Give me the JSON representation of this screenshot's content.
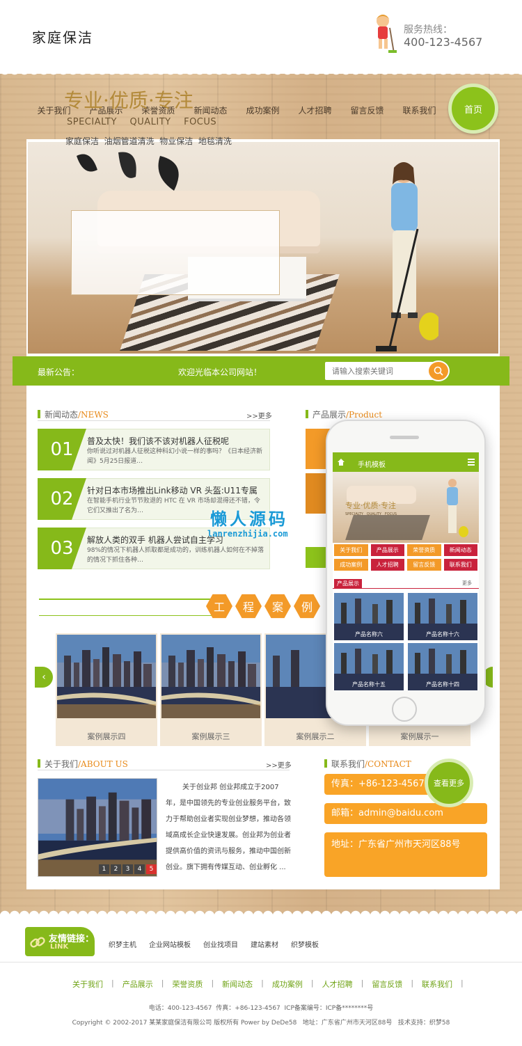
{
  "header": {
    "logo": "家庭保洁",
    "hotline_label": "服务热线：",
    "hotline_number": "400-123-4567"
  },
  "nav": {
    "items": [
      "关于我们",
      "产品展示",
      "荣誉资质",
      "新闻动态",
      "成功案例",
      "人才招聘",
      "留言反馈",
      "联系我们"
    ],
    "home": "首页"
  },
  "banner": {
    "title": "专业·优质·专注",
    "subtitle": "SPECIALTY    QUALITY    FOCUS",
    "services": "家庭保洁  油烟管道清洗  物业保洁  地毯清洗"
  },
  "notice": {
    "label": "最新公告：",
    "text": "欢迎光临本公司网站！",
    "search_placeholder": "请输入搜索关键词"
  },
  "news": {
    "title": "新闻动态",
    "title_en": "/NEWS",
    "more": ">>更多",
    "items": [
      {
        "num": "01",
        "title": "普及太快！我们该不该对机器人征税呢",
        "desc": "你听说过对机器人征税这种科幻小说一样的事吗？《日本经济新闻》5月25日报道…"
      },
      {
        "num": "02",
        "title": "针对日本市场推出Link移动 VR 头盔:U11专属",
        "desc": "在智能手机行业节节败退的 HTC 在 VR 市场却混得还不错，令它们又推出了名为…"
      },
      {
        "num": "03",
        "title": "解放人类的双手 机器人尝试自主学习",
        "desc": "98%的情况下机器人抓取都是成功的，训练机器人如何在不掉落的情况下抓住各种…"
      }
    ]
  },
  "products": {
    "title": "产品展示",
    "title_en": "/Product"
  },
  "cases": {
    "heading_chars": [
      "工",
      "程",
      "案",
      "例"
    ],
    "items": [
      "案例展示四",
      "案例展示三",
      "案例展示二",
      "案例展示一"
    ]
  },
  "about": {
    "title": "关于我们",
    "title_en": "/ABOUT US",
    "more": ">>更多",
    "text": "关于创业邦 创业邦成立于2007年，是中国领先的专业创业服务平台，致力于帮助创业者实现创业梦想，推动各领域高成长企业快速发展。创业邦为创业者提供高价值的资讯与服务，推动中国创新创业。旗下拥有传媒互动、创业孵化 ...",
    "pages": [
      "1",
      "2",
      "3",
      "4",
      "5"
    ]
  },
  "contact": {
    "title": "联系我们",
    "title_en": "/CONTACT",
    "view_more": "查看更多",
    "fax": "传真：+86-123-4567",
    "email": "邮箱：admin@baidu.com",
    "address": "地址：广东省广州市天河区88号"
  },
  "phone": {
    "header_title": "手机模板",
    "banner_title": "专业·优质·专注",
    "banner_sub": "SPECIALTY   QUALITY   FOCUS",
    "menu": [
      "关于我们",
      "产品展示",
      "荣誉资质",
      "新闻动态",
      "成功案例",
      "人才招聘",
      "留言反馈",
      "联系我们"
    ],
    "menu_colors": [
      "#f39a28",
      "#c9223c",
      "#f39a28",
      "#c9223c",
      "#f39a28",
      "#c9223c",
      "#f39a28",
      "#c9223c"
    ],
    "product_label": "产品展示",
    "product_more": "更多",
    "products": [
      "产品名称六",
      "产品名称十六",
      "产品名称十五",
      "产品名称十四"
    ]
  },
  "watermark": {
    "title": "懒人源码",
    "url": "lanrenzhijia.com"
  },
  "footer": {
    "links_title": "友情链接：",
    "links_sub": "LINK",
    "friend_links": [
      "织梦主机",
      "企业网站模板",
      "创业找项目",
      "建站素材",
      "织梦模板"
    ],
    "nav": [
      "关于我们",
      "产品展示",
      "荣誉资质",
      "新闻动态",
      "成功案例",
      "人才招聘",
      "留言反馈",
      "联系我们"
    ],
    "info": "电话：400-123-4567  传真：+86-123-4567  ICP备案编号：ICP备********号",
    "copyright": "Copyright © 2002-2017 某某家庭保洁有限公司 版权所有 Power by DeDe58   地址：广东省广州市天河区88号   技术支持：织梦58"
  },
  "colors": {
    "green": "#86b91a",
    "orange": "#f39a28",
    "red": "#c9223c"
  }
}
